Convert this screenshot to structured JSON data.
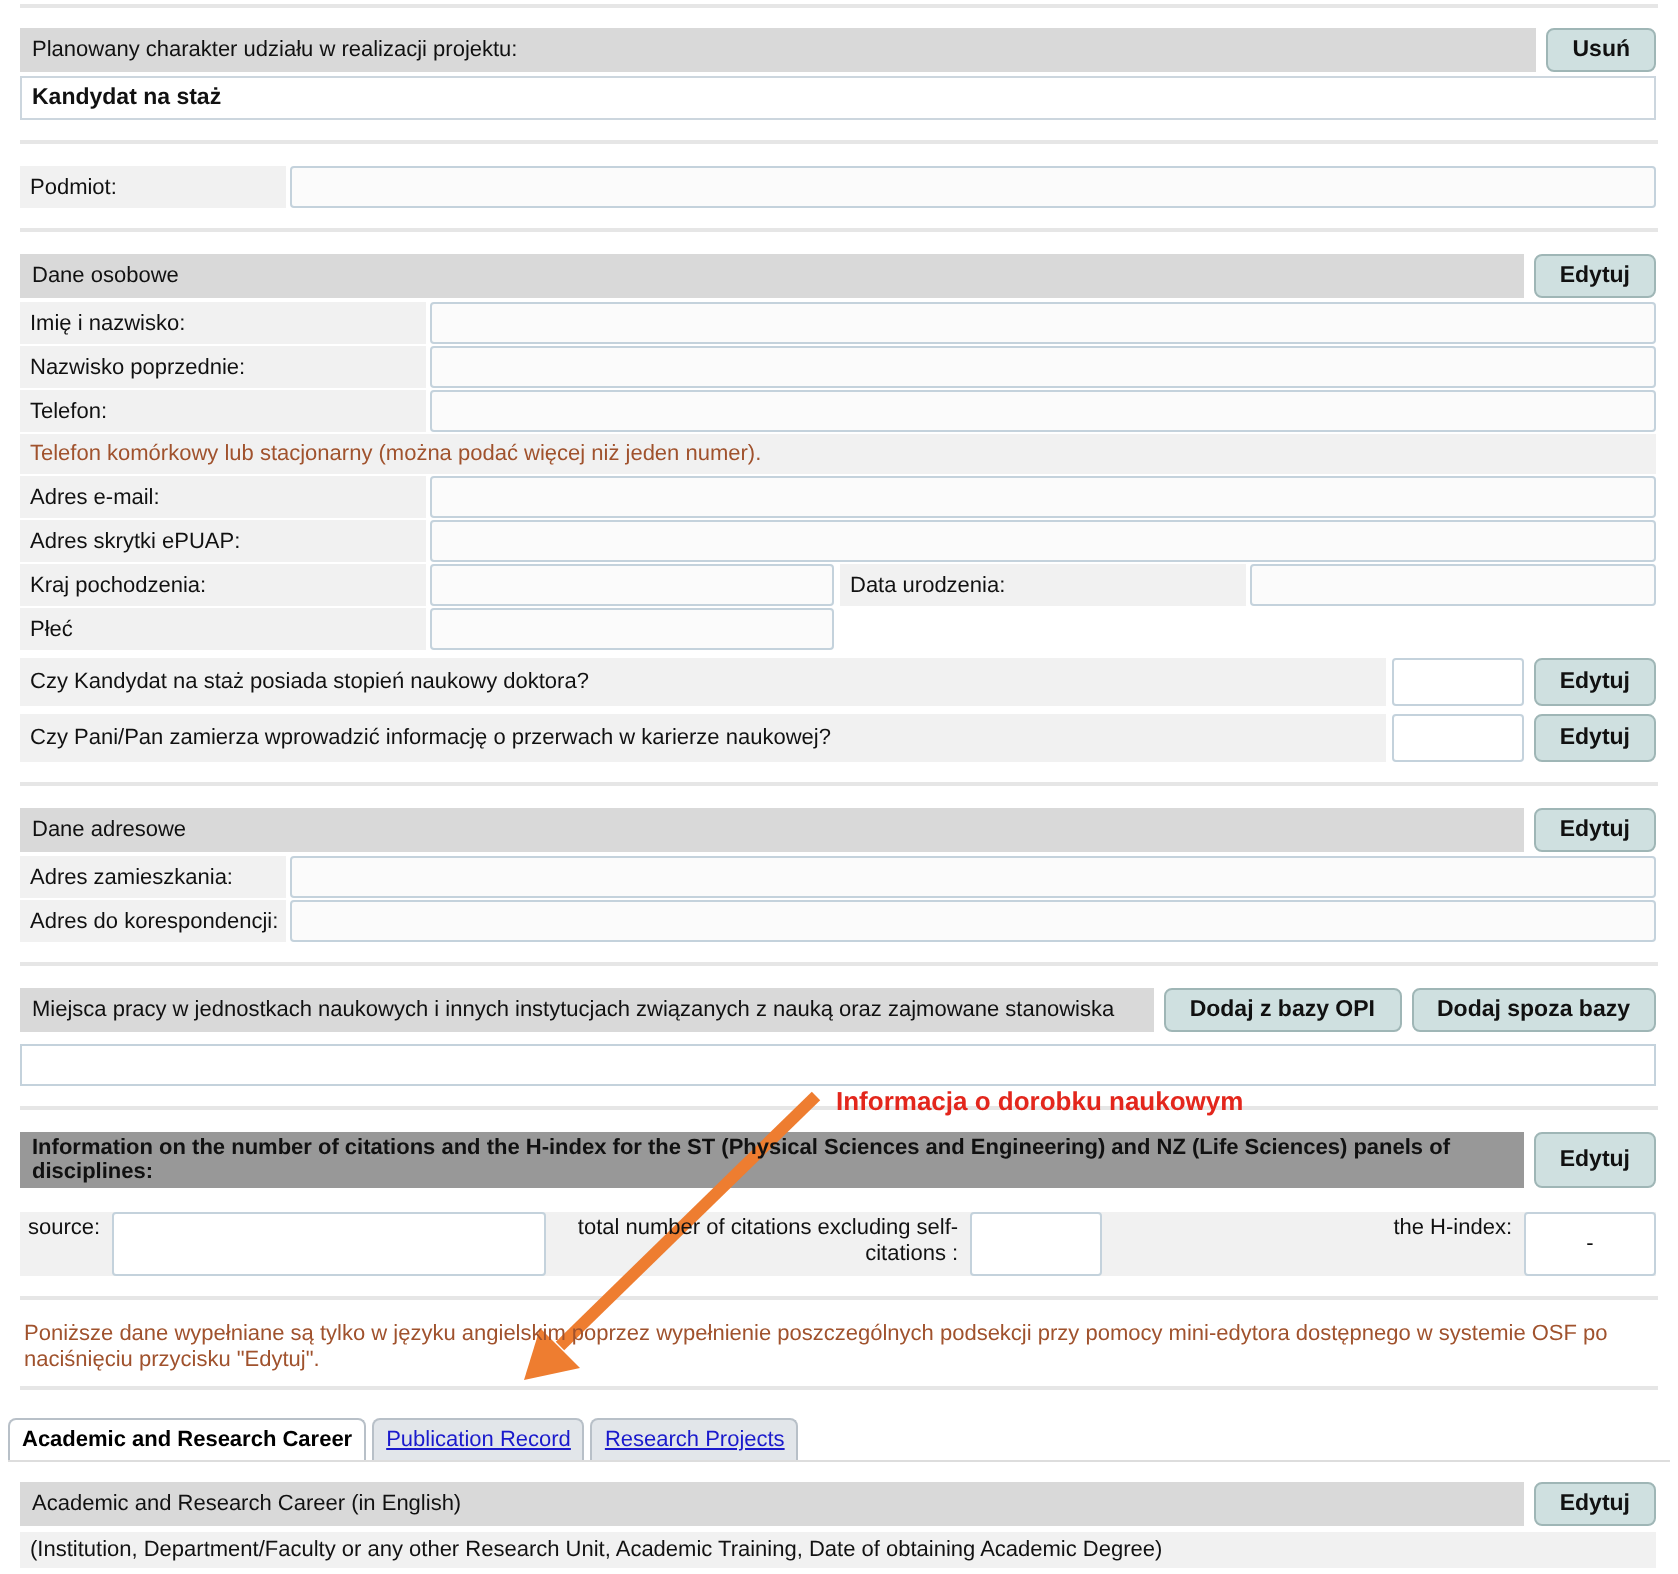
{
  "role_section": {
    "header": "Planowany charakter udziału w realizacji projektu:",
    "button": "Usuń",
    "value": "Kandydat na staż"
  },
  "entity": {
    "label": "Podmiot:"
  },
  "personal": {
    "header": "Dane osobowe",
    "button": "Edytuj",
    "rows": [
      {
        "kind": "field",
        "label": "Imię i nazwisko:"
      },
      {
        "kind": "field",
        "label": "Nazwisko poprzednie:"
      },
      {
        "kind": "field",
        "label": "Telefon:"
      },
      {
        "kind": "hint",
        "text": "Telefon komórkowy lub stacjonarny (można podać więcej niż jeden numer)."
      },
      {
        "kind": "field",
        "label": "Adres e-mail:"
      },
      {
        "kind": "field",
        "label": "Adres skrytki ePUAP:"
      },
      {
        "kind": "pair",
        "label": "Kraj pochodzenia:",
        "label2": "Data urodzenia:"
      },
      {
        "kind": "half",
        "label": "Płeć"
      },
      {
        "kind": "question",
        "label": "Czy Kandydat na staż posiada stopień naukowy doktora?",
        "button": "Edytuj"
      },
      {
        "kind": "question",
        "label": "Czy Pani/Pan zamierza wprowadzić informację o przerwach w karierze naukowej?",
        "button": "Edytuj"
      }
    ]
  },
  "address": {
    "header": "Dane adresowe",
    "button": "Edytuj",
    "rows": [
      {
        "label": "Adres zamieszkania:"
      },
      {
        "label": "Adres do korespondencji:"
      }
    ]
  },
  "workplaces": {
    "header": "Miejsca pracy w jednostkach naukowych i innych instytucjach związanych z nauką oraz zajmowane stanowiska",
    "buttons": [
      "Dodaj z bazy OPI",
      "Dodaj spoza bazy"
    ]
  },
  "citations": {
    "header": "Information on the number of citations and the H-index for the ST (Physical Sciences and Engineering) and NZ (Life Sciences) panels of disciplines:",
    "button": "Edytuj",
    "source_label": "source:",
    "citations_label": "total number of citations excluding self-citations :",
    "hindex_label": "the H-index:",
    "hindex_value": "-"
  },
  "note": "Poniższe dane wypełniane są tylko w języku angielskim poprzez wypełnienie poszczególnych podsekcji przy pomocy mini-edytora dostępnego w systemie OSF po naciśnięciu przycisku \"Edytuj\".",
  "tabs": [
    {
      "label": "Academic and Research Career",
      "selected": true
    },
    {
      "label": "Publication Record",
      "selected": false
    },
    {
      "label": "Research Projects",
      "selected": false
    }
  ],
  "career": {
    "header": "Academic and Research Career (in English)",
    "button": "Edytuj",
    "description": "(Institution, Department/Faculty or any other Research Unit, Academic Training, Date of obtaining Academic Degree)"
  },
  "annotation": {
    "text": "Informacja o dorobku naukowym"
  }
}
